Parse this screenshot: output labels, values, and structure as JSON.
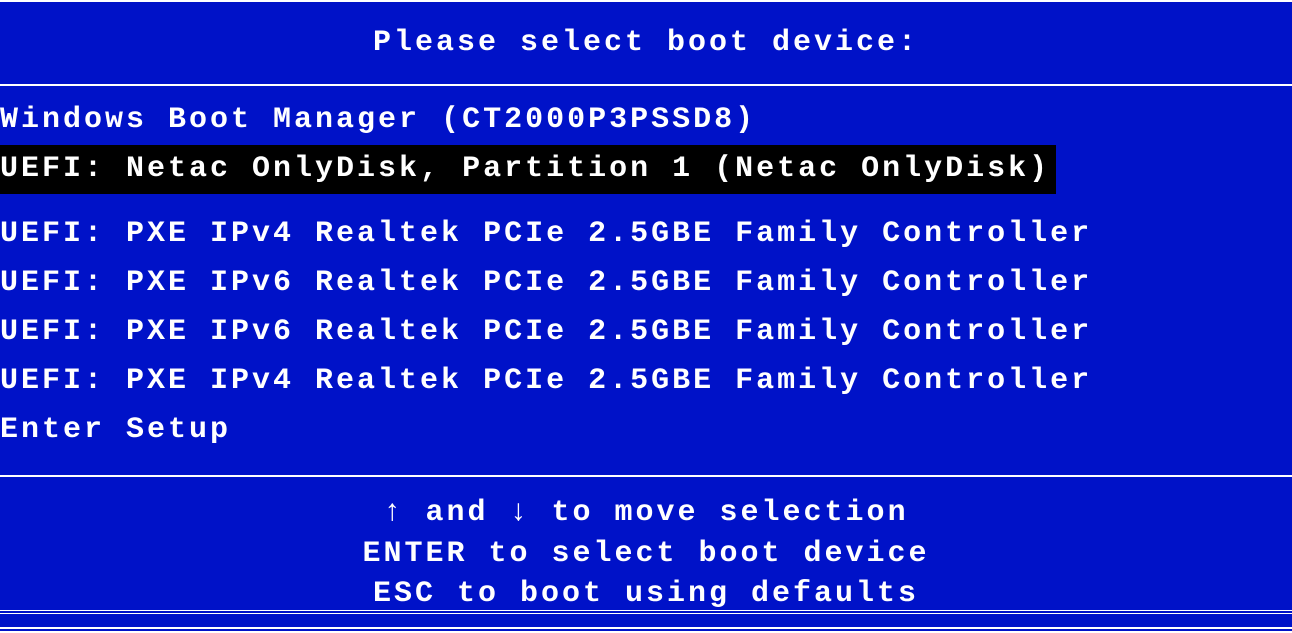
{
  "header": {
    "title": "Please select boot device:"
  },
  "boot_items": [
    {
      "label": "Windows Boot Manager (CT2000P3PSSD8)",
      "selected": false
    },
    {
      "label": "UEFI: Netac OnlyDisk, Partition 1 (Netac OnlyDisk)",
      "selected": true
    },
    {
      "label": "UEFI: PXE IPv4 Realtek PCIe 2.5GBE Family Controller",
      "selected": false
    },
    {
      "label": "UEFI: PXE IPv6 Realtek PCIe 2.5GBE Family Controller",
      "selected": false
    },
    {
      "label": "UEFI: PXE IPv6 Realtek PCIe 2.5GBE Family Controller",
      "selected": false
    },
    {
      "label": "UEFI: PXE IPv4 Realtek PCIe 2.5GBE Family Controller",
      "selected": false
    },
    {
      "label": "Enter Setup",
      "selected": false
    }
  ],
  "hints": {
    "line1_prefix": "and",
    "line1_suffix": "to move selection",
    "line2": "ENTER to select boot device",
    "line3": "ESC to boot using defaults"
  },
  "icons": {
    "up_arrow": "↑",
    "down_arrow": "↓"
  }
}
